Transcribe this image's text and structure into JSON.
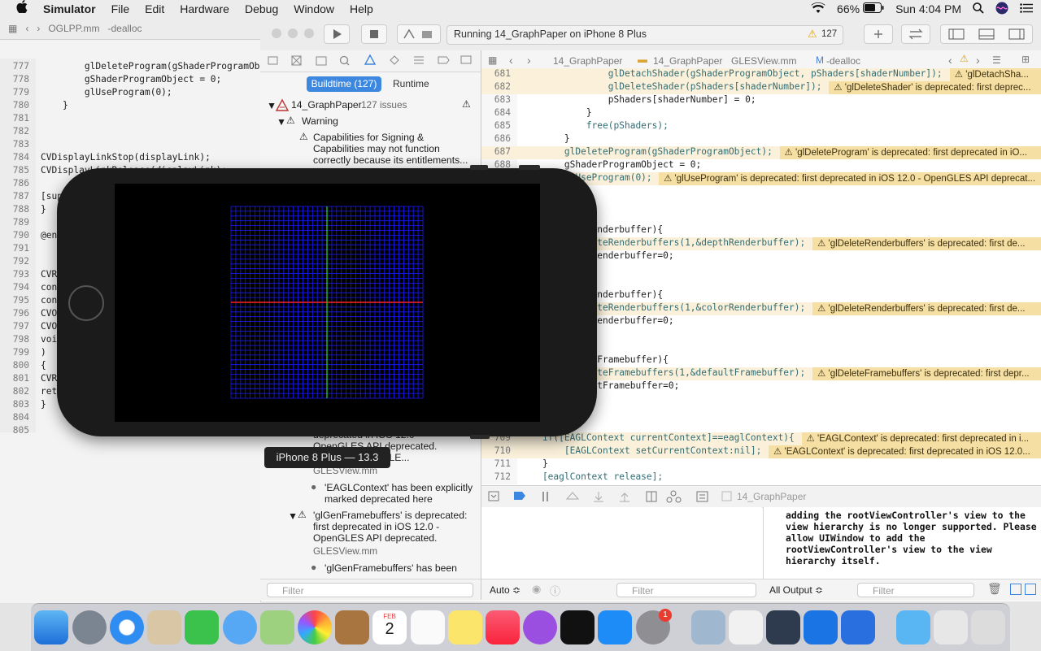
{
  "menubar": {
    "apple": "",
    "app": "Simulator",
    "items": [
      "File",
      "Edit",
      "Hardware",
      "Debug",
      "Window",
      "Help"
    ],
    "battery": "66%",
    "clock": "Sun 4:04 PM"
  },
  "back_editor": {
    "file": "OGLPP.mm",
    "symbol": "-dealloc",
    "lines": [
      {
        "n": "777",
        "t": "        glDeleteProgram(gShaderProgramObj"
      },
      {
        "n": "778",
        "t": "        gShaderProgramObject = 0;"
      },
      {
        "n": "779",
        "t": "        glUseProgram(0);"
      },
      {
        "n": "780",
        "t": "    }"
      },
      {
        "n": "781",
        "t": ""
      },
      {
        "n": "782",
        "t": ""
      },
      {
        "n": "783",
        "t": ""
      },
      {
        "n": "784",
        "t": "CVDisplayLinkStop(displayLink);"
      },
      {
        "n": "785",
        "t": "CVDisplayLinkRelease(displayLink);"
      },
      {
        "n": "786",
        "t": ""
      },
      {
        "n": "787",
        "t": "[sup"
      },
      {
        "n": "788",
        "t": "}"
      },
      {
        "n": "789",
        "t": ""
      },
      {
        "n": "790",
        "t": "@end"
      },
      {
        "n": "791",
        "t": ""
      },
      {
        "n": "792",
        "t": ""
      },
      {
        "n": "793",
        "t": "CVRe"
      },
      {
        "n": "794",
        "t": "cons"
      },
      {
        "n": "795",
        "t": "cons"
      },
      {
        "n": "796",
        "t": "CVOp"
      },
      {
        "n": "797",
        "t": "CVOp"
      },
      {
        "n": "798",
        "t": "void"
      },
      {
        "n": "799",
        "t": ")"
      },
      {
        "n": "800",
        "t": "{"
      },
      {
        "n": "801",
        "t": "CVRe"
      },
      {
        "n": "802",
        "t": "retu"
      },
      {
        "n": "803",
        "t": "}"
      },
      {
        "n": "804",
        "t": ""
      },
      {
        "n": "805",
        "t": ""
      }
    ]
  },
  "toolbar": {
    "activity": "Running 14_GraphPaper on iPhone 8 Plus",
    "warning_count": "127"
  },
  "navigator": {
    "tab_active": "Buildtime (127)",
    "tab_other": "Runtime",
    "project": "14_GraphPaper",
    "issue_count": "127 issues",
    "group": "Warning",
    "issue1": "Capabilities for Signing & Capabilities may not function correctly because its entitlements...",
    "issue_partial": "deprecated in iOS 12.0 - OpenGLES API deprecated. (Define GLES_SILE...",
    "file1": "GLESView.mm",
    "note1": "'EAGLContext' has been explicitly marked deprecated here",
    "issue2": "'glGenFramebuffers' is deprecated: first deprecated in iOS 12.0 - OpenGLES API deprecated. (Define...",
    "file2": "GLESView.mm",
    "note2": "'glGenFramebuffers' has been explicitly marked deprecated here",
    "filter_placeholder": "Filter"
  },
  "editor_bar": {
    "crumb1": "14_GraphPaper",
    "crumb2": "14_GraphPaper",
    "crumb3": "GLESView.mm",
    "crumb4": "-dealloc"
  },
  "editor": {
    "lines": [
      {
        "n": "681",
        "t": "                glDetachShader(gShaderProgramObject, pShaders[shaderNumber]);",
        "w": "'glDetachSha..."
      },
      {
        "n": "682",
        "t": "                glDeleteShader(pShaders[shaderNumber]);",
        "w": "'glDeleteShader' is deprecated: first deprec..."
      },
      {
        "n": "683",
        "t": "                pShaders[shaderNumber] = 0;",
        "w": ""
      },
      {
        "n": "684",
        "t": "            }",
        "w": ""
      },
      {
        "n": "685",
        "t": "            free(pShaders);",
        "w": ""
      },
      {
        "n": "686",
        "t": "        }",
        "w": ""
      },
      {
        "n": "687",
        "t": "        glDeleteProgram(gShaderProgramObject);",
        "w": "'glDeleteProgram' is deprecated: first deprecated in iO..."
      },
      {
        "n": "688",
        "t": "        gShaderProgramObject = 0;",
        "w": ""
      },
      {
        "n": "689",
        "t": "        glUseProgram(0);",
        "w": "'glUseProgram' is deprecated: first deprecated in iOS 12.0 - OpenGLES API deprecat..."
      },
      {
        "n": "690",
        "t": "",
        "w": ""
      },
      {
        "n": "691",
        "t": "",
        "w": ""
      },
      {
        "n": "692",
        "t": "",
        "w": ""
      },
      {
        "n": "693",
        "t": "    if(depthRenderbuffer){",
        "w": ""
      },
      {
        "n": "694",
        "t": "        glDeleteRenderbuffers(1,&depthRenderbuffer);",
        "w": "'glDeleteRenderbuffers' is deprecated: first de..."
      },
      {
        "n": "695",
        "t": "        depthRenderbuffer=0;",
        "w": ""
      },
      {
        "n": "696",
        "t": "    }",
        "w": ""
      },
      {
        "n": "697",
        "t": "",
        "w": ""
      },
      {
        "n": "698",
        "t": "    if(colorRenderbuffer){",
        "w": ""
      },
      {
        "n": "699",
        "t": "        glDeleteRenderbuffers(1,&colorRenderbuffer);",
        "w": "'glDeleteRenderbuffers' is deprecated: first de..."
      },
      {
        "n": "700",
        "t": "        colorRenderbuffer=0;",
        "w": ""
      },
      {
        "n": "701",
        "t": "    }",
        "w": ""
      },
      {
        "n": "702",
        "t": "",
        "w": ""
      },
      {
        "n": "703",
        "t": "    if(defaultFramebuffer){",
        "w": ""
      },
      {
        "n": "704",
        "t": "        glDeleteFramebuffers(1,&defaultFramebuffer);",
        "w": "'glDeleteFramebuffers' is deprecated: first depr..."
      },
      {
        "n": "705",
        "t": "        defaultFramebuffer=0;",
        "w": ""
      },
      {
        "n": "706",
        "t": "    }",
        "w": ""
      },
      {
        "n": "707",
        "t": "",
        "w": ""
      },
      {
        "n": "708",
        "t": "",
        "w": ""
      },
      {
        "n": "709",
        "t": "    if([EAGLContext currentContext]==eaglContext){",
        "w": "'EAGLContext' is deprecated: first deprecated in i..."
      },
      {
        "n": "710",
        "t": "        [EAGLContext setCurrentContext:nil];",
        "w": "'EAGLContext' is deprecated: first deprecated in iOS 12.0..."
      },
      {
        "n": "711",
        "t": "    }",
        "w": ""
      },
      {
        "n": "712",
        "t": "    [eaglContext release];",
        "w": ""
      }
    ]
  },
  "debug": {
    "target": "14_GraphPaper",
    "console": "adding the rootViewController's view to the\nview hierarchy is no longer supported. Please\nallow UIWindow to add the\nrootViewController's view to the view\nhierarchy itself.",
    "auto_label": "Auto ≎",
    "output_label": "All Output ≎",
    "filter_placeholder": "Filter"
  },
  "simulator": {
    "tooltip": "iPhone 8 Plus — 13.3",
    "grid_color": "#1a1aff",
    "x_axis_color": "#ff2020",
    "y_axis_color": "#20c020"
  },
  "dock": {
    "calendar_month": "FEB",
    "calendar_day": "2",
    "badge": "1"
  }
}
